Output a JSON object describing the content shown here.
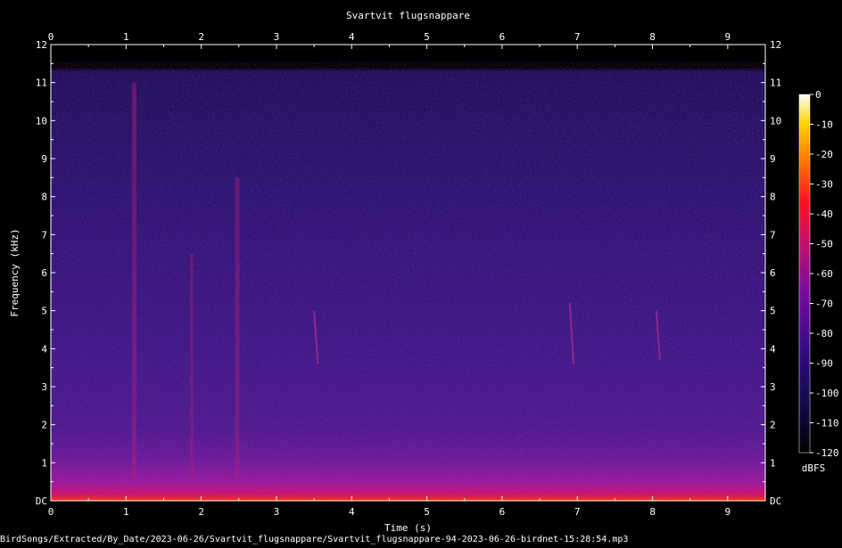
{
  "chart_data": {
    "type": "heatmap",
    "title": "Svartvit flugsnappare",
    "xlabel": "Time (s)",
    "ylabel": "Frequency (kHz)",
    "xlim": [
      0,
      9.5
    ],
    "ylim": [
      0,
      12
    ],
    "x_ticks": [
      "0",
      "1",
      "2",
      "3",
      "4",
      "5",
      "6",
      "7",
      "8",
      "9"
    ],
    "y_ticks": [
      "DC",
      "1",
      "2",
      "3",
      "4",
      "5",
      "6",
      "7",
      "8",
      "9",
      "10",
      "11",
      "12"
    ],
    "colorbar": {
      "label": "dBFS",
      "range": [
        -120,
        0
      ],
      "ticks": [
        "0",
        "-10",
        "-20",
        "-30",
        "-40",
        "-50",
        "-60",
        "-70",
        "-80",
        "-90",
        "-100",
        "-110",
        "-120"
      ]
    },
    "grid": false
  },
  "footer": {
    "file_path": "BirdSongs/Extracted/By_Date/2023-06-26/Svartvit_flugsnappare/Svartvit_flugsnappare-94-2023-06-26-birdnet-15:28:54.mp3"
  }
}
